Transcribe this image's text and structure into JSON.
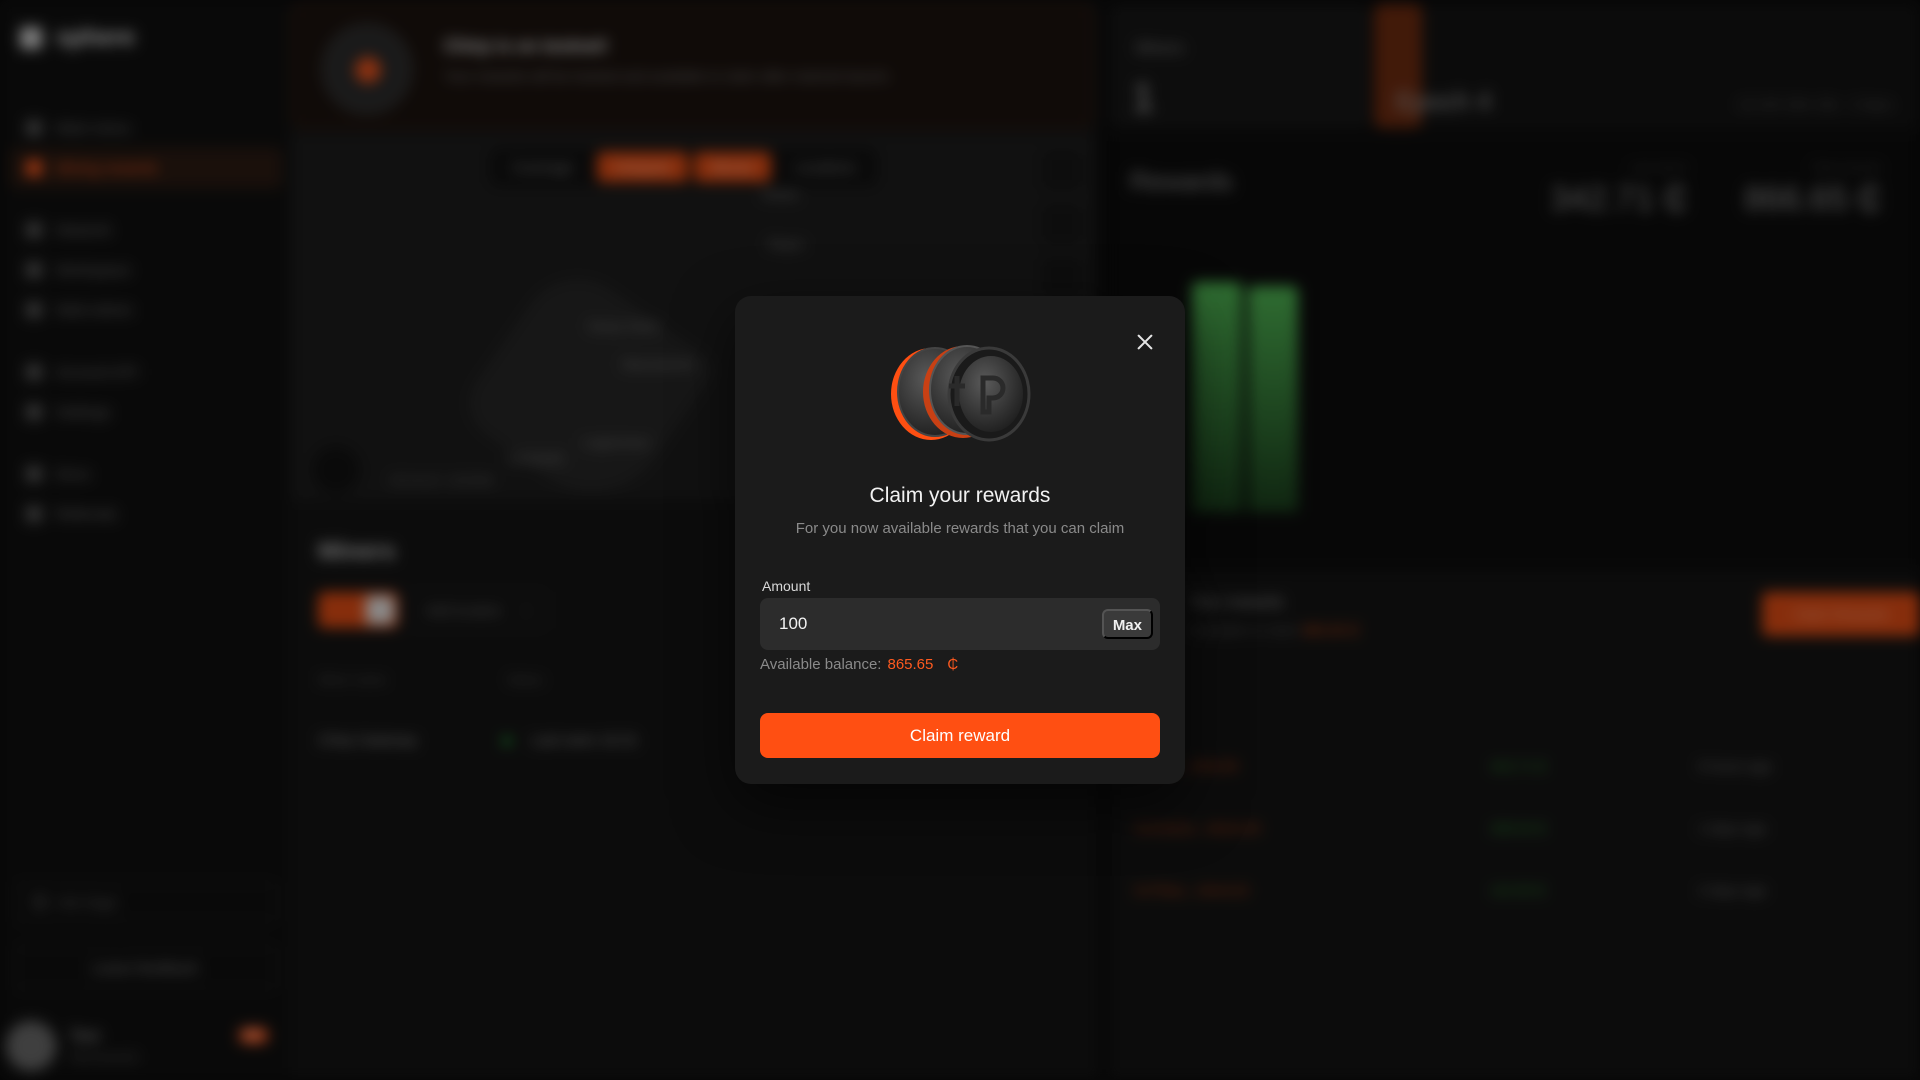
{
  "app": {
    "logo": "sphere"
  },
  "sidebar": {
    "items": [
      {
        "label": "Main menu",
        "icon": "home-icon"
      },
      {
        "label": "Mining rewards",
        "icon": "wallet-icon",
        "active": true
      },
      {
        "label": "Network",
        "icon": "network-icon"
      },
      {
        "label": "Workspace",
        "icon": "grid-icon"
      },
      {
        "label": "Web Admin",
        "icon": "admin-icon"
      },
      {
        "label": "Account API",
        "icon": "key-icon"
      },
      {
        "label": "Settings",
        "icon": "gear-icon"
      },
      {
        "label": "Docs",
        "icon": "doc-icon"
      },
      {
        "label": "Referrals",
        "icon": "users-icon"
      }
    ],
    "search_placeholder": "Ask Sage",
    "leave_feedback": "Leave feedback",
    "user": {
      "name": "Test",
      "sub": "Test account",
      "badge": "99+"
    }
  },
  "banner": {
    "title": "Chirp is on testnet!",
    "text": "Your rewards will be tracked and available to claim after mainnet launch."
  },
  "map": {
    "tabs": [
      "Coverage",
      "Hotspots",
      "Blocks",
      "Locations"
    ],
    "active_tabs": [
      1,
      2
    ],
    "labels": [
      "Nowa",
      "Rejon",
      "Nowy Dwór",
      "Mazowiecki",
      "Legionowo",
      "Łomianki"
    ],
    "scale": "SCALE  1000M"
  },
  "miners": {
    "title": "Miners",
    "add_location": "Add location",
    "headers": [
      "Miner name",
      "Status"
    ],
    "rows": [
      {
        "name": "Chirp Gateway",
        "status": "Last seen 16:31"
      }
    ]
  },
  "epoch": {
    "label": "Miners",
    "count": "1",
    "title": "Epoch 4",
    "time": "1d 14h 18m 18s",
    "days": "2 days"
  },
  "rewards": {
    "title": "Rewards",
    "stats": [
      {
        "label": "Last epoch",
        "value": "342.71 ₵"
      },
      {
        "label": "Total rewards",
        "value": "866.65 ₵"
      }
    ]
  },
  "claim_section": {
    "title": "Your rewards",
    "subtitle_prefix": "Available to claim",
    "subtitle_value": "865.65 ₵",
    "button": "Claim Rewards",
    "rows": [
      {
        "id": "0x1a5e...8f2d1f6",
        "amount": "342.71 ₵",
        "time": "9 hours ago"
      },
      {
        "id": "0x4c8d1b...4b3e1d5",
        "amount": "268.93 ₵",
        "time": "1 days ago"
      },
      {
        "id": "0x7f3aa...c9e4c2d",
        "amount": "115.05 ₵",
        "time": "2 days ago"
      }
    ]
  },
  "modal": {
    "title": "Claim your rewards",
    "subtitle": "For you now available rewards that you can claim",
    "amount_label": "Amount",
    "amount_value": "100",
    "max_label": "Max",
    "balance_label": "Available balance:",
    "balance_value": "865.65",
    "currency_symbol": "₵",
    "claim_button": "Claim reward",
    "accent_color": "#ff4f12"
  }
}
